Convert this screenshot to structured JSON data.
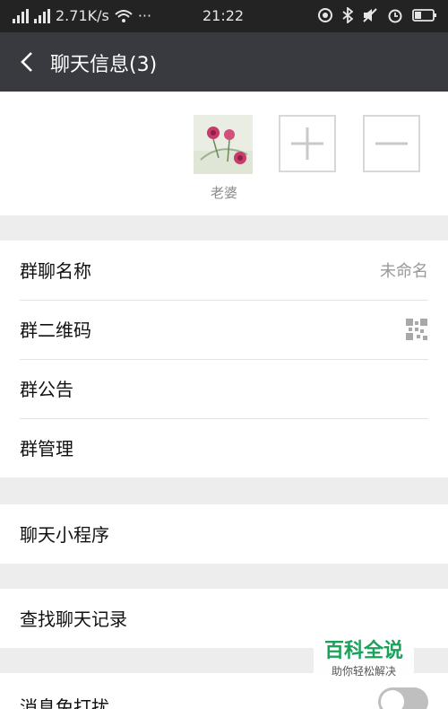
{
  "status_bar": {
    "network_speed": "2.71K/s",
    "time": "21:22",
    "dots": "···"
  },
  "header": {
    "title": "聊天信息(3)"
  },
  "members": {
    "list": [
      {
        "name": "老婆"
      }
    ]
  },
  "settings": {
    "group_name_label": "群聊名称",
    "group_name_value": "未命名",
    "qr_code_label": "群二维码",
    "announcement_label": "群公告",
    "manage_label": "群管理",
    "mini_program_label": "聊天小程序",
    "search_history_label": "查找聊天记录",
    "mute_label": "消息免打扰",
    "mute_enabled": false
  },
  "watermark": {
    "main": "百科全说",
    "sub": "助你轻松解决"
  }
}
